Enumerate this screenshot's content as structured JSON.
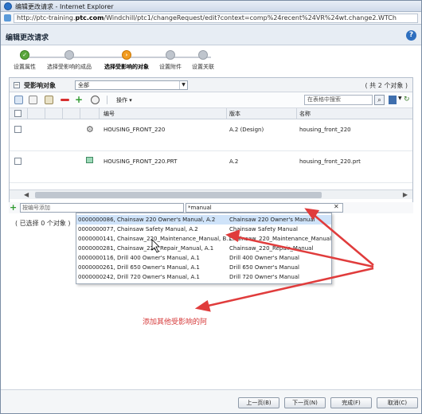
{
  "window": {
    "title": "编辑更改请求 - Internet Explorer",
    "url_pre": "http://ptc-training.",
    "url_bold": "ptc.com",
    "url_post": "/Windchill/ptc1/changeRequest/edit?context=comp%24recent%24VR%24wt.change2.WTCh"
  },
  "dialog": {
    "title": "编辑更改请求",
    "help": "?"
  },
  "steps": [
    {
      "label": "设置属性",
      "state": "done"
    },
    {
      "label": "选择受影响的成品",
      "state": "todo"
    },
    {
      "label": "选择受影响的对象",
      "state": "current"
    },
    {
      "label": "设置附件",
      "state": "todo"
    },
    {
      "label": "设置关联",
      "state": "todo"
    }
  ],
  "panel": {
    "title": "受影响对象",
    "filter_value": "全部",
    "count": "( 共 2 个对象 )",
    "actions_label": "操作 ▾",
    "search_placeholder": "在表格中搜索",
    "columns": {
      "number": "编号",
      "version": "版本",
      "name": "名称"
    },
    "rows": [
      {
        "number": "HOUSING_FRONT_220",
        "version": "A.2 (Design)",
        "name": "housing_front_220",
        "icon": "gear-part-icon"
      },
      {
        "number": "HOUSING_FRONT_220.PRT",
        "version": "A.2",
        "name": "housing_front_220.prt",
        "icon": "cad-part-icon"
      }
    ]
  },
  "add_row": {
    "number_placeholder": "按编号添加",
    "name_value": "*manual"
  },
  "selection_info": "( 已选择 0 个对象 )",
  "suggestions": [
    {
      "left": "0000000086, Chainsaw 220 Owner's Manual, A.2",
      "right": "Chainsaw 220 Owner's Manual",
      "highlight": true
    },
    {
      "left": "0000000077, Chainsaw Safety Manual, A.2",
      "right": "Chainsaw Safety Manual",
      "highlight": false
    },
    {
      "left": "0000000141, Chainsaw_220_Maintenance_Manual, B.1",
      "right": "Chainsaw_220_Maintenance_Manual",
      "highlight": false
    },
    {
      "left": "0000000281, Chainsaw_220_Repair_Manual, A.1",
      "right": "Chainsaw_220_Repair_Manual",
      "highlight": false
    },
    {
      "left": "0000000116, Drill 400 Owner's Manual, A.1",
      "right": "Drill 400 Owner's Manual",
      "highlight": false
    },
    {
      "left": "0000000261, Drill 650 Owner's Manual, A.1",
      "right": "Drill 650 Owner's Manual",
      "highlight": false
    },
    {
      "left": "0000000242, Drill 720 Owner's Manual, A.1",
      "right": "Drill 720 Owner's Manual",
      "highlight": false
    }
  ],
  "annotation": "添加其他受影响的阿",
  "buttons": {
    "prev": "上一页(B)",
    "next": "下一页(N)",
    "finish": "完成(F)",
    "cancel": "取消(C)"
  },
  "colors": {
    "accent_arrow": "#e03c3c",
    "step_current": "#f29c1f",
    "step_done": "#5aa63d",
    "highlight": "#cfe3f9"
  }
}
